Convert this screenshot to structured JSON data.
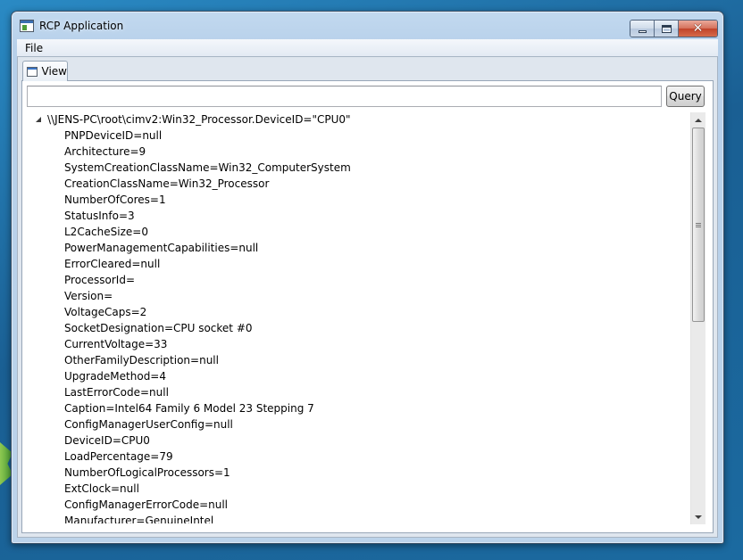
{
  "window": {
    "title": "RCP Application"
  },
  "menu": {
    "items": [
      "File"
    ]
  },
  "tab": {
    "label": "View"
  },
  "query": {
    "input_value": "",
    "button_label": "Query"
  },
  "tree": {
    "root": "\\\\JENS-PC\\root\\cimv2:Win32_Processor.DeviceID=\"CPU0\"",
    "children": [
      "PNPDeviceID=null",
      "Architecture=9",
      "SystemCreationClassName=Win32_ComputerSystem",
      "CreationClassName=Win32_Processor",
      "NumberOfCores=1",
      "StatusInfo=3",
      "L2CacheSize=0",
      "PowerManagementCapabilities=null",
      "ErrorCleared=null",
      "ProcessorId=",
      "Version=",
      "VoltageCaps=2",
      "SocketDesignation=CPU socket #0",
      "CurrentVoltage=33",
      "OtherFamilyDescription=null",
      "UpgradeMethod=4",
      "LastErrorCode=null",
      "Caption=Intel64 Family 6 Model 23 Stepping 7",
      "ConfigManagerUserConfig=null",
      "DeviceID=CPU0",
      "LoadPercentage=79",
      "NumberOfLogicalProcessors=1",
      "ExtClock=null",
      "ConfigManagerErrorCode=null",
      "Manufacturer=GenuineIntel"
    ]
  },
  "icons": {
    "app": "app-window-icon",
    "tab": "view-window-icon",
    "expander": "tree-expanded-icon"
  }
}
